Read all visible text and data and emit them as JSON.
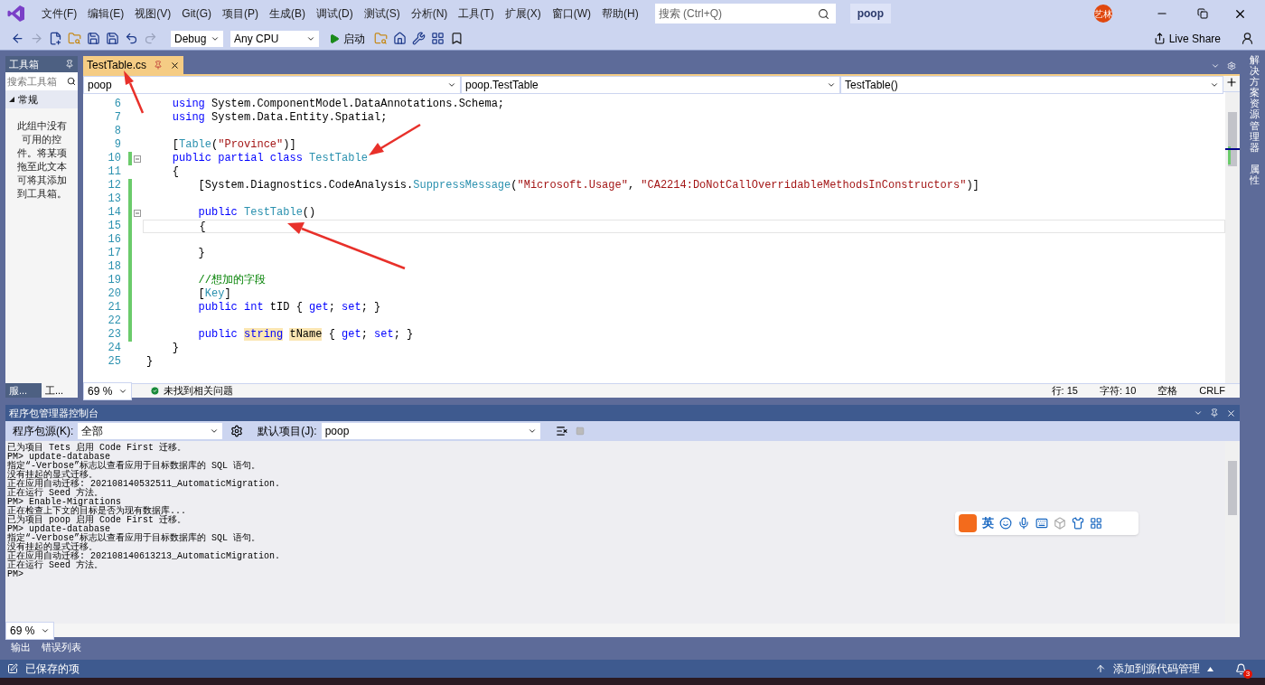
{
  "window": {
    "menu": [
      "文件(F)",
      "编辑(E)",
      "视图(V)",
      "Git(G)",
      "项目(P)",
      "生成(B)",
      "调试(D)",
      "测试(S)",
      "分析(N)",
      "工具(T)",
      "扩展(X)",
      "窗口(W)",
      "帮助(H)"
    ],
    "search": {
      "placeholder": "搜索 (Ctrl+Q)"
    },
    "solution": "poop",
    "avatar": "艺林"
  },
  "toolbar": {
    "configuration": "Debug",
    "platform": "Any CPU",
    "start": "启动",
    "live_share": "Live Share"
  },
  "toolbox": {
    "title": "工具箱",
    "search": {
      "placeholder": "搜索工具箱"
    },
    "group": {
      "label": "常规",
      "expanded": true
    },
    "message": "此组中没有可用的控件。将某项拖至此文本可将其添加到工具箱。",
    "tabs": [
      {
        "label": "服...",
        "selected": false
      },
      {
        "label": "工...",
        "selected": true
      }
    ]
  },
  "editor": {
    "tab": {
      "label": "TestTable.cs",
      "selected": true
    },
    "nav": [
      "poop",
      "poop.TestTable",
      "TestTable()"
    ],
    "lines": [
      {
        "number": "6",
        "changed": false,
        "current": false,
        "foldable": false,
        "tokens": [
          {
            "kind": "keyword",
            "text": "    using"
          },
          {
            "kind": "plain",
            "text": " System.ComponentModel.DataAnnotations.Schema;"
          }
        ]
      },
      {
        "number": "7",
        "changed": false,
        "current": false,
        "foldable": false,
        "tokens": [
          {
            "kind": "keyword",
            "text": "    using"
          },
          {
            "kind": "plain",
            "text": " System.Data.Entity.Spatial;"
          }
        ]
      },
      {
        "number": "8",
        "changed": false,
        "current": false,
        "foldable": false
      },
      {
        "number": "9",
        "changed": false,
        "current": false,
        "foldable": false,
        "tokens": [
          {
            "kind": "plain",
            "text": "    ["
          },
          {
            "kind": "type",
            "text": "Table"
          },
          {
            "kind": "plain",
            "text": "("
          },
          {
            "kind": "string",
            "text": "\"Province\""
          },
          {
            "kind": "plain",
            "text": ")]"
          }
        ]
      },
      {
        "number": "10",
        "changed": true,
        "current": false,
        "foldable": true,
        "tokens": [
          {
            "kind": "keyword",
            "text": "    public partial class"
          },
          {
            "kind": "type",
            "text": " TestTable"
          }
        ]
      },
      {
        "number": "11",
        "changed": false,
        "current": false,
        "foldable": false,
        "tokens": [
          {
            "kind": "plain",
            "text": "    {"
          }
        ]
      },
      {
        "number": "12",
        "changed": true,
        "current": false,
        "foldable": false,
        "tokens": [
          {
            "kind": "plain",
            "text": "        [System.Diagnostics.CodeAnalysis."
          },
          {
            "kind": "type",
            "text": "SuppressMessage"
          },
          {
            "kind": "plain",
            "text": "("
          },
          {
            "kind": "string",
            "text": "\"Microsoft.Usage\""
          },
          {
            "kind": "plain",
            "text": ", "
          },
          {
            "kind": "string",
            "text": "\"CA2214:DoNotCallOverridableMethodsInConstructors\""
          },
          {
            "kind": "plain",
            "text": ")]"
          }
        ]
      },
      {
        "number": "13",
        "changed": true,
        "current": false,
        "foldable": false
      },
      {
        "number": "14",
        "changed": true,
        "current": false,
        "foldable": true,
        "tokens": [
          {
            "kind": "keyword",
            "text": "        public"
          },
          {
            "kind": "type",
            "text": " TestTable"
          },
          {
            "kind": "plain",
            "text": "()"
          }
        ]
      },
      {
        "number": "15",
        "changed": true,
        "current": true,
        "foldable": false,
        "tokens": [
          {
            "kind": "plain",
            "text": "        {"
          }
        ]
      },
      {
        "number": "16",
        "changed": true,
        "current": false,
        "foldable": false
      },
      {
        "number": "17",
        "changed": true,
        "current": false,
        "foldable": false,
        "tokens": [
          {
            "kind": "plain",
            "text": "        }"
          }
        ]
      },
      {
        "number": "18",
        "changed": true,
        "current": false,
        "foldable": false
      },
      {
        "number": "19",
        "changed": true,
        "current": false,
        "foldable": false,
        "tokens": [
          {
            "kind": "comment",
            "text": "        //想加的字段"
          }
        ]
      },
      {
        "number": "20",
        "changed": true,
        "current": false,
        "foldable": false,
        "tokens": [
          {
            "kind": "plain",
            "text": "        ["
          },
          {
            "kind": "type",
            "text": "Key"
          },
          {
            "kind": "plain",
            "text": "]"
          }
        ]
      },
      {
        "number": "21",
        "changed": true,
        "current": false,
        "foldable": false,
        "tokens": [
          {
            "kind": "keyword",
            "text": "        public int"
          },
          {
            "kind": "plain",
            "text": " tID { "
          },
          {
            "kind": "keyword",
            "text": "get"
          },
          {
            "kind": "plain",
            "text": "; "
          },
          {
            "kind": "keyword",
            "text": "set"
          },
          {
            "kind": "plain",
            "text": "; }"
          }
        ]
      },
      {
        "number": "22",
        "changed": true,
        "current": false,
        "foldable": false
      },
      {
        "number": "23",
        "changed": true,
        "current": false,
        "foldable": false,
        "tokens": [
          {
            "kind": "keyword",
            "text": "        public "
          },
          {
            "kind": "keyword-ref",
            "text": "string"
          },
          {
            "kind": "plain-ref",
            "text": "tName"
          },
          {
            "kind": "plain",
            "text": " { "
          },
          {
            "kind": "keyword",
            "text": "get"
          },
          {
            "kind": "plain",
            "text": "; "
          },
          {
            "kind": "keyword",
            "text": "set"
          },
          {
            "kind": "plain",
            "text": "; }"
          }
        ]
      },
      {
        "number": "24",
        "changed": false,
        "current": false,
        "foldable": false,
        "tokens": [
          {
            "kind": "plain",
            "text": "    }"
          }
        ]
      },
      {
        "number": "25",
        "changed": false,
        "current": false,
        "foldable": false,
        "tokens": [
          {
            "kind": "plain",
            "text": "}"
          }
        ]
      }
    ],
    "zoom": "69 %",
    "issues": "未找到相关问题",
    "position": [
      "行: 15",
      "字符: 10",
      "空格",
      "CRLF"
    ]
  },
  "side_tabs": [
    "解决方案资源管理器",
    "属性"
  ],
  "console": {
    "title": "程序包管理器控制台",
    "source_label": "程序包源(K):",
    "source": "全部",
    "project_label": "默认项目(J):",
    "project": "poop",
    "zoom": "69 %",
    "output": [
      "已为项目 Tets 启用 Code First 迁移。",
      "PM> update-database",
      "指定“-Verbose”标志以查看应用于目标数据库的 SQL 语句。",
      "没有挂起的显式迁移。",
      "正在应用自动迁移: 202108140532511_AutomaticMigration.",
      "正在运行 Seed 方法。",
      "PM> Enable-Migrations",
      "正在检查上下文的目标是否为现有数据库...",
      "已为项目 poop 启用 Code First 迁移。",
      "PM> update-database",
      "指定“-Verbose”标志以查看应用于目标数据库的 SQL 语句。",
      "没有挂起的显式迁移。",
      "正在应用自动迁移: 202108140613213_AutomaticMigration.",
      "正在运行 Seed 方法。",
      "PM>"
    ]
  },
  "bottom_tabs": [
    {
      "label": "输出",
      "selected": false
    },
    {
      "label": "错误列表",
      "selected": false
    }
  ],
  "status_bar": {
    "message": "已保存的项",
    "source_control": "添加到源代码管理",
    "notifications": "3"
  },
  "ime": {
    "mode": "英"
  }
}
